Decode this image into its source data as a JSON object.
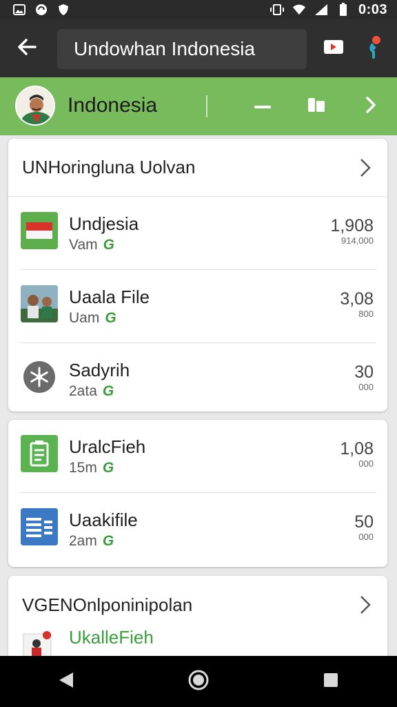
{
  "status_bar": {
    "icons": [
      "photo-icon",
      "sync-icon",
      "shield-icon",
      "vibrate-icon",
      "wifi-icon",
      "signal-icon",
      "battery-icon"
    ],
    "time": "0:03"
  },
  "app_bar": {
    "back_icon": "arrow-back-icon",
    "search_value": "Undowhan Indonesia",
    "actions": [
      "video-camera-icon",
      "person-pin-icon"
    ]
  },
  "country_band": {
    "name": "Indonesia",
    "actions": [
      "minus-icon",
      "bookmark-icon",
      "chevron-right-icon"
    ],
    "background": "#77bb5c"
  },
  "section1": {
    "header": "UNHoringluna Uolvan",
    "rows": [
      {
        "icon": "indonesia-flag-icon",
        "title": "Undjesia",
        "sub": "Vam",
        "tag": "G",
        "value": "1,908",
        "value_small": "914,000"
      },
      {
        "icon": "group-photo-icon",
        "title": "Uaala File",
        "sub": "Uam",
        "tag": "G",
        "value": "3,08",
        "value_small": "800"
      },
      {
        "icon": "snowflake-icon",
        "title": "Sadyrih",
        "sub": "2ata",
        "tag": "G",
        "value": "30",
        "value_small": "000"
      }
    ]
  },
  "section2": {
    "rows": [
      {
        "icon": "clipboard-icon",
        "title": "UralcFieh",
        "sub": "15m",
        "tag": "G",
        "value": "1,08",
        "value_small": "000"
      },
      {
        "icon": "document-list-icon",
        "title": "Uaakifile",
        "sub": "2am",
        "tag": "G",
        "value": "50",
        "value_small": "000"
      }
    ]
  },
  "section3": {
    "header": "VGENOnlponinipolan",
    "partial_item": {
      "icon": "pinned-file-icon",
      "title": "UkalleFieh"
    }
  },
  "nav_bar": {
    "buttons": [
      "nav-back-icon",
      "nav-home-icon",
      "nav-recents-icon"
    ]
  }
}
